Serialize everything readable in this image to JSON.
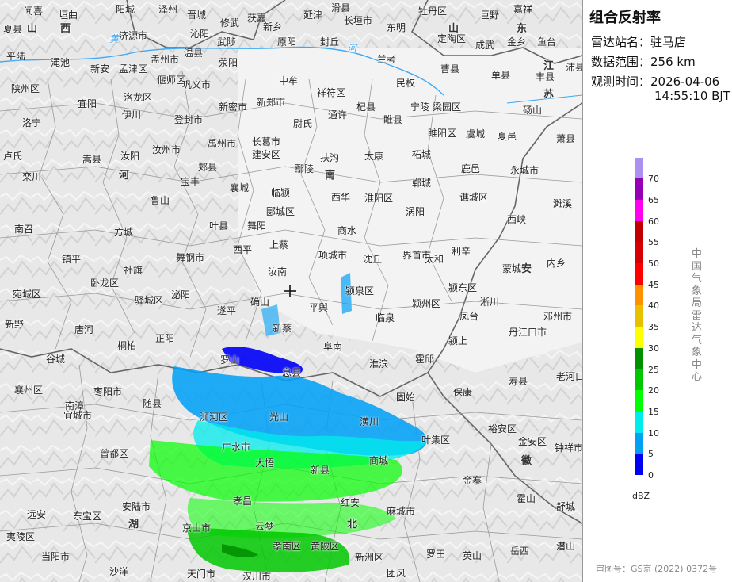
{
  "title": "组合反射率",
  "station": {
    "label": "雷达站名：",
    "value": "驻马店"
  },
  "range": {
    "label": "数据范围：",
    "value": "256 km"
  },
  "obs_time": {
    "label": "观测时间：",
    "date": "2026-04-06",
    "time": "14:55:10 BJT"
  },
  "colorbar": {
    "unit": "dBZ",
    "levels": [
      {
        "value": "0",
        "color": "#0000f6"
      },
      {
        "value": "5",
        "color": "#01a0f6"
      },
      {
        "value": "10",
        "color": "#00ecec"
      },
      {
        "value": "15",
        "color": "#01ff00"
      },
      {
        "value": "20",
        "color": "#00c800"
      },
      {
        "value": "25",
        "color": "#019000"
      },
      {
        "value": "30",
        "color": "#ffff00"
      },
      {
        "value": "35",
        "color": "#e7c000"
      },
      {
        "value": "40",
        "color": "#ff9000"
      },
      {
        "value": "45",
        "color": "#ff0000"
      },
      {
        "value": "50",
        "color": "#d60000"
      },
      {
        "value": "55",
        "color": "#c00000"
      },
      {
        "value": "60",
        "color": "#ff00f0"
      },
      {
        "value": "65",
        "color": "#9600b4"
      },
      {
        "value": "70",
        "color": "#ad90f0"
      }
    ]
  },
  "organization": "中国气象局雷达气象中心",
  "approval": "审图号：GS京 (2022) 0372号",
  "map": {
    "provinces": [
      "山",
      "西",
      "山",
      "东",
      "河",
      "南",
      "江",
      "苏",
      "安",
      "徽",
      "湖",
      "北"
    ],
    "rivers": [
      "黄",
      "河"
    ],
    "cities": [
      "闻喜",
      "垣曲",
      "阳城",
      "泽州",
      "晋城",
      "沁阳",
      "修武",
      "获嘉",
      "新乡",
      "延津",
      "滑县",
      "长垣市",
      "东明",
      "牡丹区",
      "巨野",
      "嘉祥",
      "夏县",
      "济源市",
      "温县",
      "武陟",
      "原阳",
      "封丘",
      "定陶区",
      "成武",
      "金乡",
      "鱼台",
      "平陆",
      "渑池",
      "新安",
      "孟津区",
      "孟州市",
      "荥阳",
      "中牟",
      "兰考",
      "曹县",
      "单县",
      "丰县",
      "沛县",
      "陕州区",
      "洛龙区",
      "偃师区",
      "巩义市",
      "祥符区",
      "民权",
      "宜阳",
      "伊川",
      "新密市",
      "新郑市",
      "通许",
      "杞县",
      "睢县",
      "宁陵",
      "梁园区",
      "砀山",
      "洛宁",
      "登封市",
      "尉氏",
      "睢阳区",
      "虞城",
      "夏邑",
      "卢氏",
      "嵩县",
      "汝阳",
      "汝州市",
      "禹州市",
      "长葛市",
      "建安区",
      "扶沟",
      "太康",
      "柘城",
      "萧县",
      "郏县",
      "鄢陵",
      "鹿邑",
      "永城市",
      "栾川",
      "宝丰",
      "襄城",
      "临颍",
      "西华",
      "淮阳区",
      "郸城",
      "谯城区",
      "濉溪",
      "鲁山",
      "叶县",
      "舞阳",
      "郾城区",
      "商水",
      "涡阳",
      "西峡",
      "南召",
      "方城",
      "舞钢市",
      "西平",
      "上蔡",
      "项城市",
      "沈丘",
      "界首市",
      "太和",
      "利辛",
      "蒙城",
      "内乡",
      "镇平",
      "卧龙区",
      "社旗",
      "泌阳",
      "遂平",
      "汝南",
      "平舆",
      "颍泉区",
      "颍东区",
      "淅川",
      "宛城区",
      "驿城区",
      "确山",
      "新蔡",
      "临泉",
      "颍州区",
      "凤台",
      "邓州市",
      "唐河",
      "正阳",
      "阜南",
      "颍上",
      "丹江口市",
      "新野",
      "桐柏",
      "罗山",
      "息县",
      "淮滨",
      "霍邱",
      "寿县",
      "老河口市",
      "谷城",
      "襄州区",
      "枣阳市",
      "随县",
      "浉河区",
      "光山",
      "潢川",
      "固始",
      "保康",
      "南漳",
      "宜城市",
      "曾都区",
      "广水市",
      "大悟",
      "新县",
      "商城",
      "叶集区",
      "裕安区",
      "金安区",
      "钟祥市",
      "安陆市",
      "孝昌",
      "红安",
      "麻城市",
      "金寨",
      "霍山",
      "舒城",
      "远安",
      "东宝区",
      "京山市",
      "云梦",
      "孝南区",
      "黄陂区",
      "新洲区",
      "罗田",
      "英山",
      "岳西",
      "潜山",
      "当阳市",
      "沙洋",
      "天门市",
      "汉川市",
      "团风",
      "夷陵区",
      "荆门市",
      "驻马店站"
    ]
  }
}
